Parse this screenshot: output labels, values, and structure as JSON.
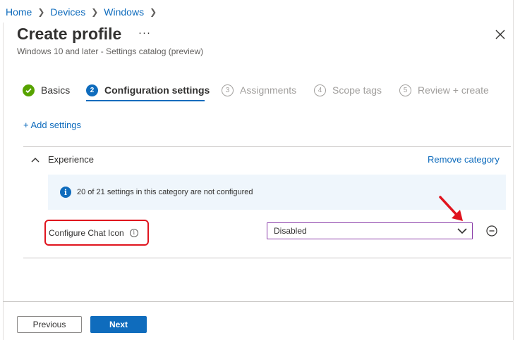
{
  "breadcrumb": [
    {
      "label": "Home"
    },
    {
      "label": "Devices"
    },
    {
      "label": "Windows"
    }
  ],
  "page": {
    "title": "Create profile",
    "more_label": "···",
    "subtitle": "Windows 10 and later - Settings catalog (preview)"
  },
  "steps": [
    {
      "number": "✓",
      "label": "Basics",
      "state": "done"
    },
    {
      "number": "2",
      "label": "Configuration settings",
      "state": "active"
    },
    {
      "number": "3",
      "label": "Assignments",
      "state": "pending"
    },
    {
      "number": "4",
      "label": "Scope tags",
      "state": "pending"
    },
    {
      "number": "5",
      "label": "Review + create",
      "state": "pending"
    }
  ],
  "add_settings_label": "+ Add settings",
  "category": {
    "name": "Experience",
    "remove_label": "Remove category",
    "info_icon": "i",
    "info_message": "20 of 21 settings in this category are not configured"
  },
  "setting": {
    "label": "Configure Chat Icon",
    "info_icon": "i",
    "selected_value": "Disabled"
  },
  "footer": {
    "previous_label": "Previous",
    "next_label": "Next"
  },
  "colors": {
    "accent": "#0f6cbd",
    "success": "#57a300",
    "highlight": "#e0141e",
    "dropdown_border": "#8a3ca8",
    "banner_bg": "#eff6fc"
  },
  "icons": [
    "chevron-right-icon",
    "close-icon",
    "check-circle-icon",
    "chevron-up-icon",
    "info-icon",
    "chevron-down-icon",
    "remove-circle-icon",
    "red-arrow-annotation"
  ]
}
